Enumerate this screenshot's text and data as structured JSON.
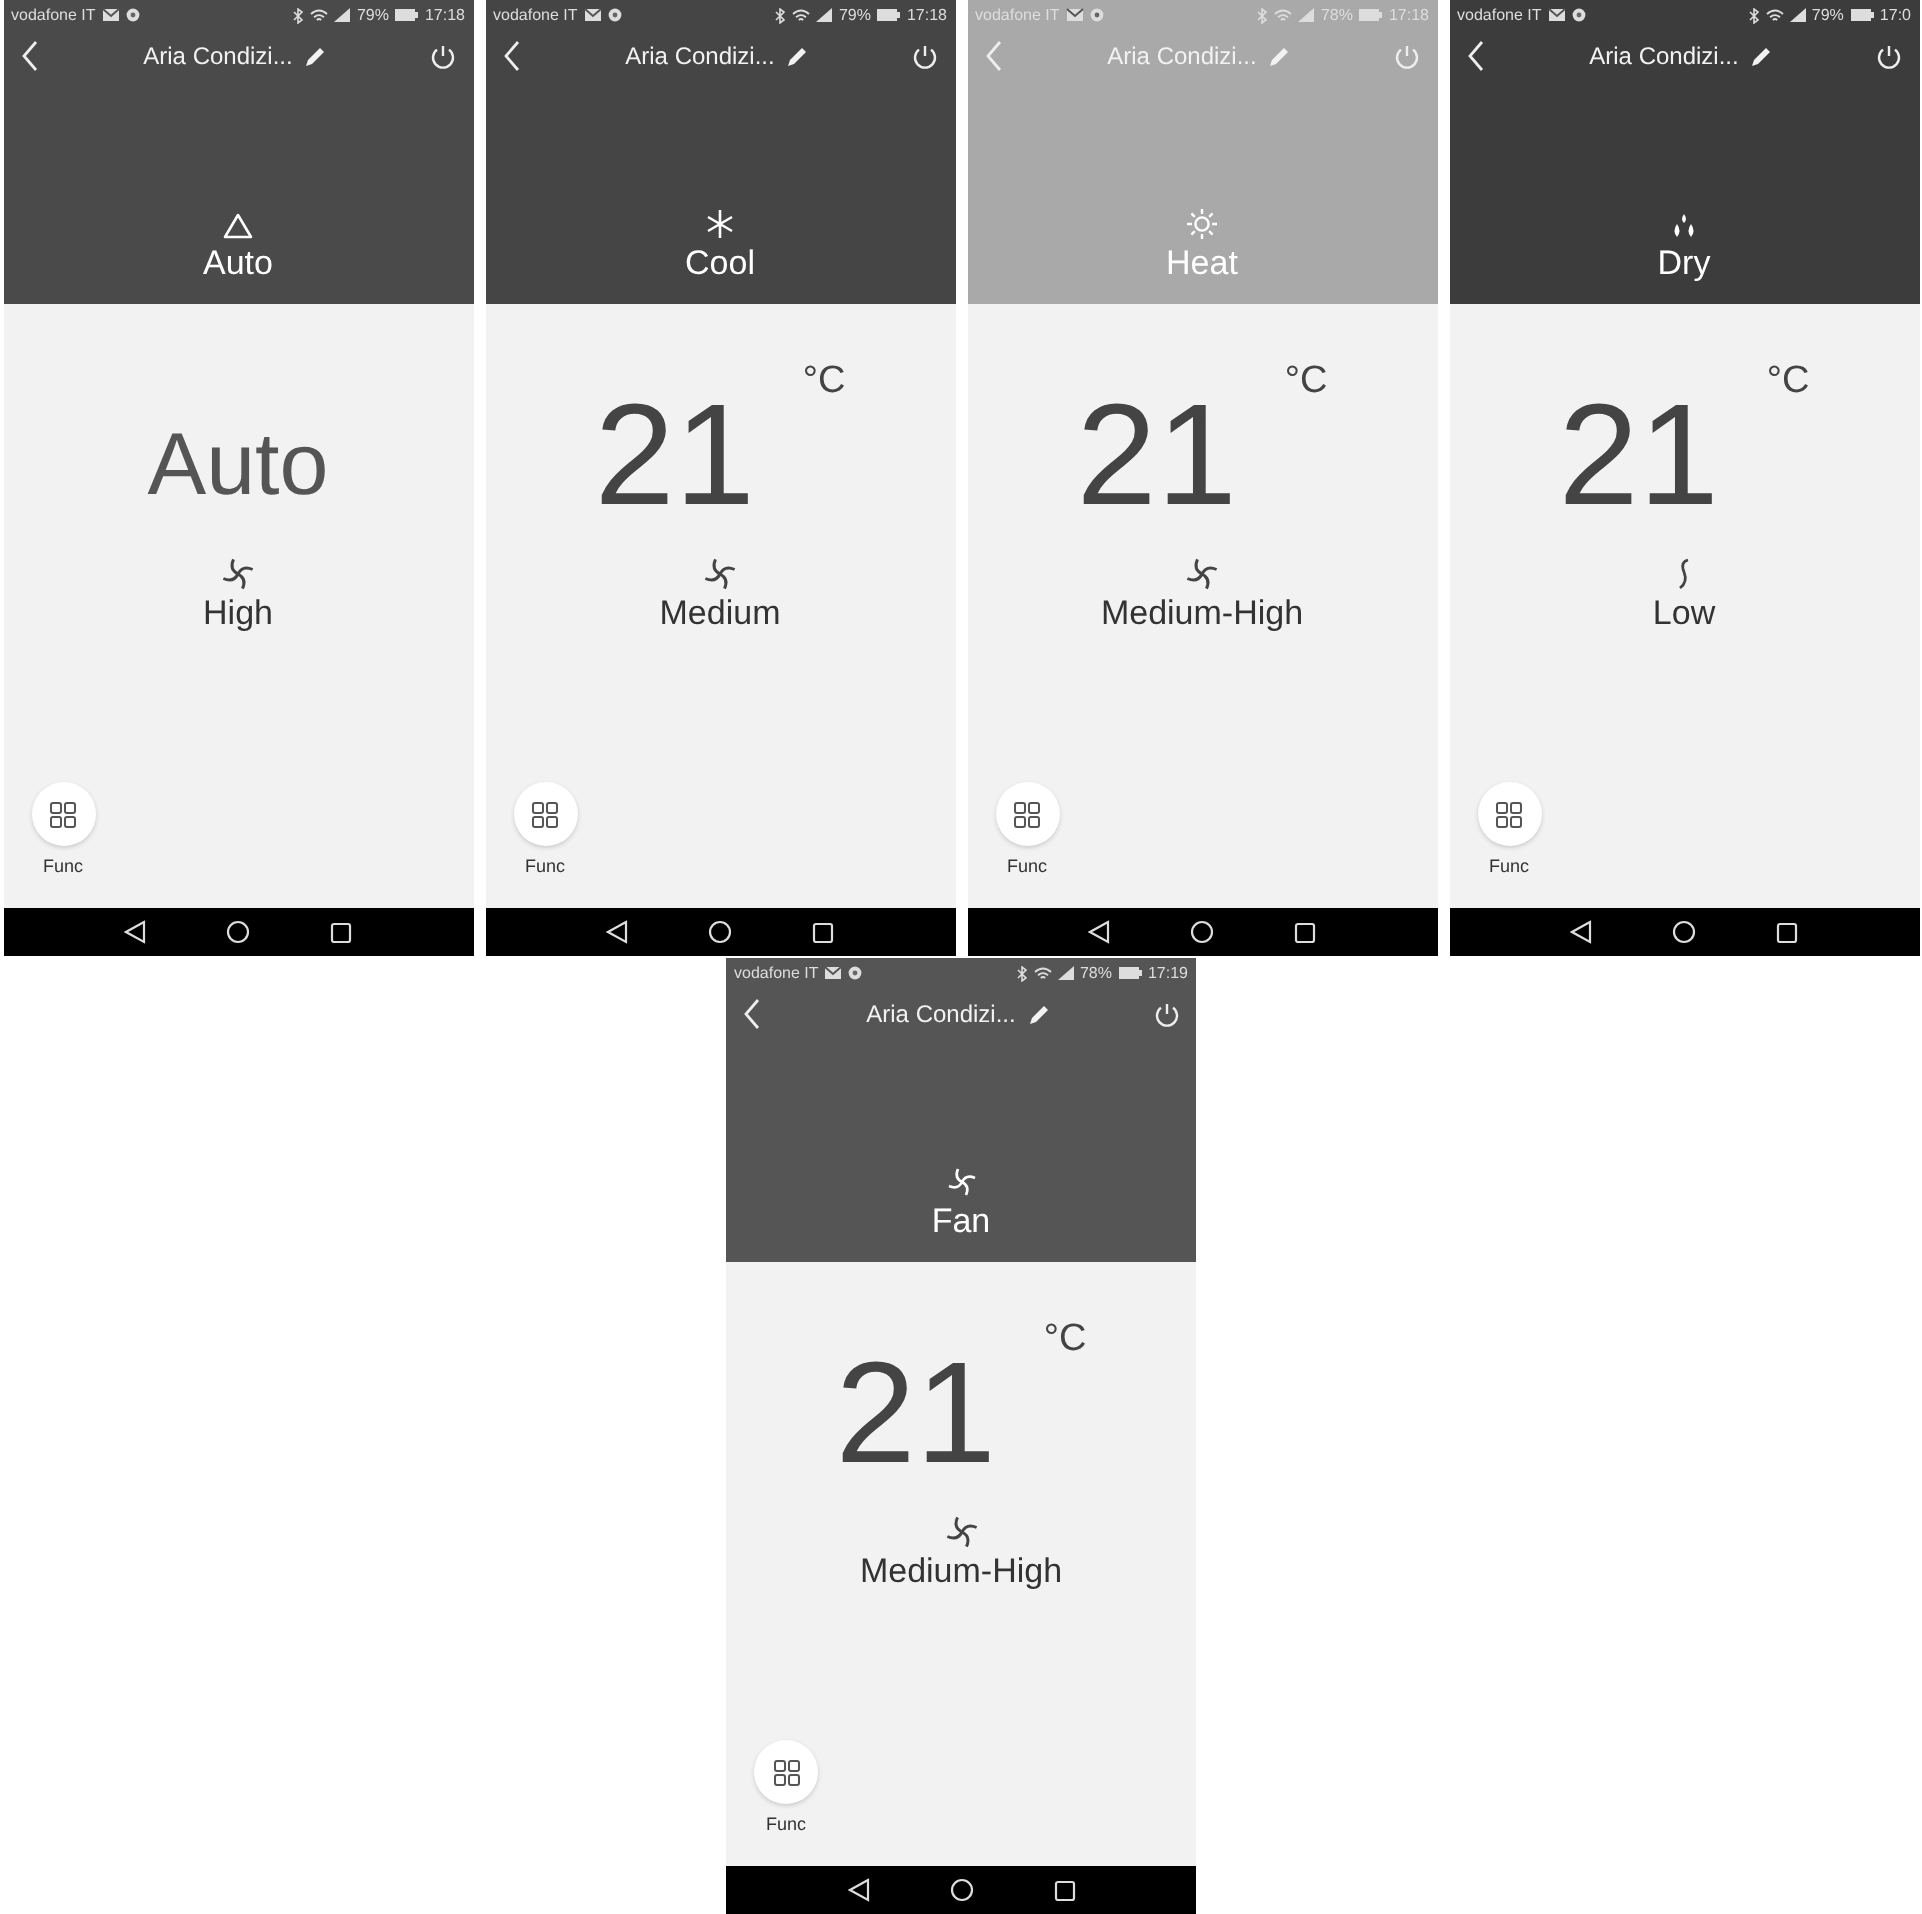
{
  "phones": [
    {
      "status_bar": {
        "carrier": "vodafone IT",
        "battery": "79%",
        "time": "17:18"
      },
      "header": {
        "title": "Aria Condizi..."
      },
      "mode": {
        "kind": "auto",
        "label": "Auto"
      },
      "setpoint": {
        "kind": "text",
        "value": "Auto"
      },
      "fan": {
        "kind": "swirl",
        "label": "High"
      },
      "func_button": {
        "label": "Func"
      }
    },
    {
      "status_bar": {
        "carrier": "vodafone IT",
        "battery": "79%",
        "time": "17:18"
      },
      "header": {
        "title": "Aria Condizi..."
      },
      "mode": {
        "kind": "cool",
        "label": "Cool"
      },
      "setpoint": {
        "kind": "temperature",
        "value": "21",
        "unit": "°C"
      },
      "fan": {
        "kind": "swirl",
        "label": "Medium"
      },
      "func_button": {
        "label": "Func"
      }
    },
    {
      "status_bar": {
        "carrier": "vodafone IT",
        "battery": "78%",
        "time": "17:18"
      },
      "header": {
        "title": "Aria Condizi..."
      },
      "mode": {
        "kind": "heat",
        "label": "Heat"
      },
      "setpoint": {
        "kind": "temperature",
        "value": "21",
        "unit": "°C"
      },
      "fan": {
        "kind": "swirl",
        "label": "Medium-High"
      },
      "func_button": {
        "label": "Func"
      }
    },
    {
      "status_bar": {
        "carrier": "vodafone IT",
        "battery": "79%",
        "time": "17:0"
      },
      "header": {
        "title": "Aria Condizi..."
      },
      "mode": {
        "kind": "dry",
        "label": "Dry"
      },
      "setpoint": {
        "kind": "temperature",
        "value": "21",
        "unit": "°C"
      },
      "fan": {
        "kind": "single",
        "label": "Low"
      },
      "func_button": {
        "label": "Func"
      }
    },
    {
      "status_bar": {
        "carrier": "vodafone IT",
        "battery": "78%",
        "time": "17:19"
      },
      "header": {
        "title": "Aria Condizi..."
      },
      "mode": {
        "kind": "fan",
        "label": "Fan"
      },
      "setpoint": {
        "kind": "temperature",
        "value": "21",
        "unit": "°C"
      },
      "fan": {
        "kind": "swirl",
        "label": "Medium-High"
      },
      "func_button": {
        "label": "Func"
      }
    }
  ]
}
